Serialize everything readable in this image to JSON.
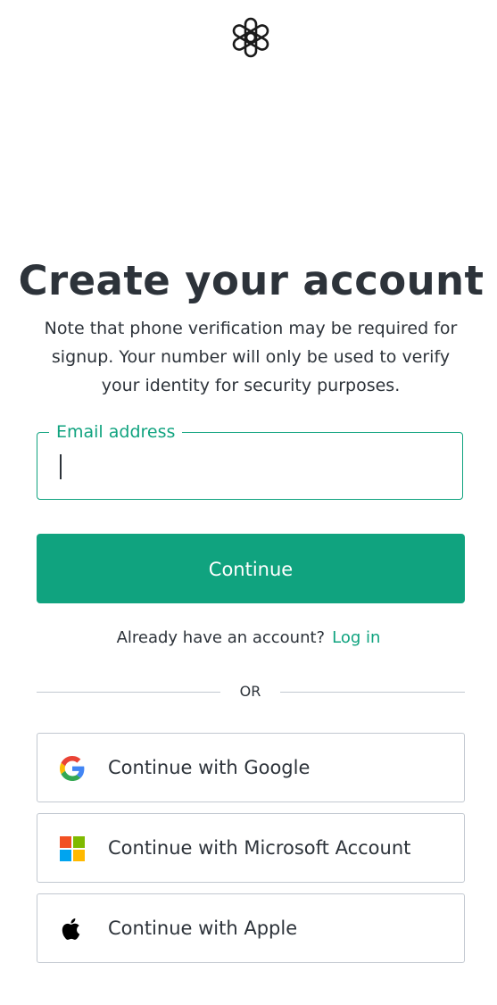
{
  "brand": {
    "logo_icon": "openai-logo-icon",
    "accent_color": "#10a37f",
    "text_color": "#2d333a",
    "border_color": "#c2c8d0"
  },
  "heading": {
    "title": "Create your account",
    "subtitle": "Note that phone verification may be required for signup. Your number will only be used to verify your identity for security purposes."
  },
  "email": {
    "label": "Email address",
    "value": "",
    "placeholder": ""
  },
  "continue_label": "Continue",
  "login": {
    "prompt": "Already have an account?",
    "link_label": "Log in"
  },
  "divider_label": "OR",
  "social": {
    "google": {
      "label": "Continue with Google",
      "icon": "google-icon"
    },
    "microsoft": {
      "label": "Continue with Microsoft Account",
      "icon": "microsoft-icon"
    },
    "apple": {
      "label": "Continue with Apple",
      "icon": "apple-icon"
    }
  }
}
